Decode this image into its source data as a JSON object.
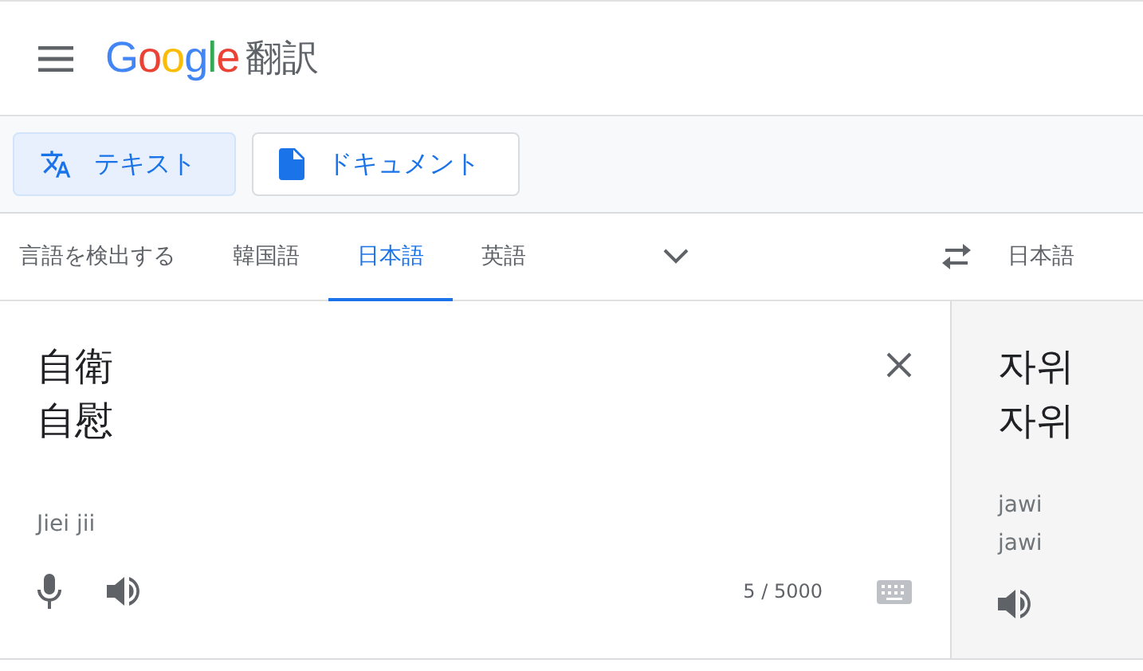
{
  "header": {
    "logo": "Google",
    "title": "翻訳"
  },
  "modes": [
    {
      "label": "テキスト",
      "kind": "text",
      "selected": true
    },
    {
      "label": "ドキュメント",
      "kind": "document",
      "selected": false
    }
  ],
  "source_languages": [
    {
      "label": "言語を検出する",
      "selected": false
    },
    {
      "label": "韓国語",
      "selected": false
    },
    {
      "label": "日本語",
      "selected": true
    },
    {
      "label": "英語",
      "selected": false
    }
  ],
  "target_languages": [
    {
      "label": "日本語",
      "selected": false
    }
  ],
  "source": {
    "lines": [
      "自衛",
      "自慰"
    ],
    "romanization": "Jiei jii",
    "counter": "5 / 5000"
  },
  "target": {
    "lines": [
      "자위",
      "자위"
    ],
    "romanization": [
      "jawi",
      "jawi"
    ]
  }
}
